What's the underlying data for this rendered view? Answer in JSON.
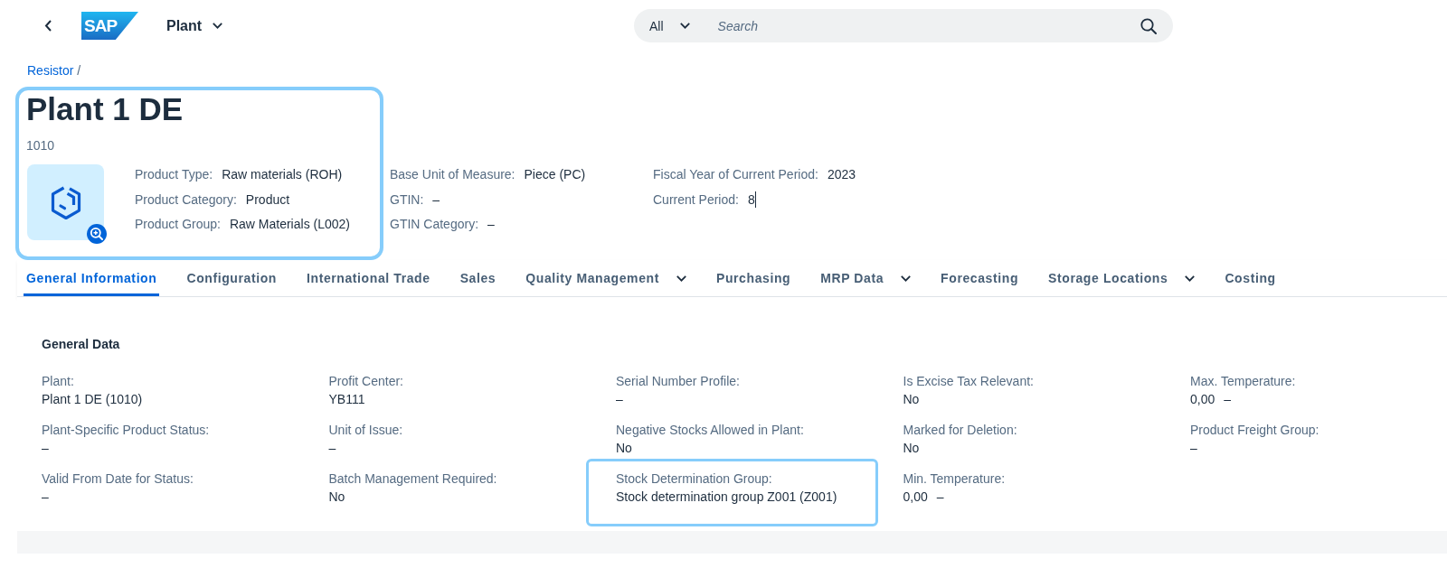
{
  "shell": {
    "logo": "SAP",
    "product_title": "Plant",
    "search": {
      "scope": "All",
      "placeholder": "Search"
    }
  },
  "breadcrumb": {
    "links": [
      "Resistor"
    ],
    "separator": "/"
  },
  "header": {
    "title": "Plant 1 DE",
    "subtitle": "1010",
    "highlighted": true,
    "attribute_columns": [
      [
        {
          "label": "Product Type:",
          "value": "Raw materials (ROH)",
          "cursor": false
        },
        {
          "label": "Product Category:",
          "value": "Product",
          "cursor": false
        },
        {
          "label": "Product Group:",
          "value": "Raw Materials (L002)",
          "cursor": false
        }
      ],
      [
        {
          "label": "Base Unit of Measure:",
          "value": "Piece (PC)",
          "cursor": false
        },
        {
          "label": "GTIN:",
          "value": "–",
          "cursor": false
        },
        {
          "label": "GTIN Category:",
          "value": "–",
          "cursor": false
        }
      ],
      [
        {
          "label": "Fiscal Year of Current Period:",
          "value": "2023",
          "cursor": false
        },
        {
          "label": "Current Period:",
          "value": "8",
          "cursor": true
        }
      ]
    ]
  },
  "tabs": [
    {
      "label": "General Information",
      "selected": true,
      "has_menu": false
    },
    {
      "label": "Configuration",
      "selected": false,
      "has_menu": false
    },
    {
      "label": "International Trade",
      "selected": false,
      "has_menu": false
    },
    {
      "label": "Sales",
      "selected": false,
      "has_menu": false
    },
    {
      "label": "Quality Management",
      "selected": false,
      "has_menu": true
    },
    {
      "label": "Purchasing",
      "selected": false,
      "has_menu": false
    },
    {
      "label": "MRP Data",
      "selected": false,
      "has_menu": true
    },
    {
      "label": "Forecasting",
      "selected": false,
      "has_menu": false
    },
    {
      "label": "Storage Locations",
      "selected": false,
      "has_menu": true
    },
    {
      "label": "Costing",
      "selected": false,
      "has_menu": false
    }
  ],
  "section": {
    "title": "General Data",
    "fields": [
      {
        "label": "Plant:",
        "value": "Plant 1 DE (1010)",
        "highlighted": false
      },
      {
        "label": "Profit Center:",
        "value": "YB111",
        "highlighted": false
      },
      {
        "label": "Serial Number Profile:",
        "value": "–",
        "highlighted": false
      },
      {
        "label": "Is Excise Tax Relevant:",
        "value": "No",
        "highlighted": false
      },
      {
        "label": "Max. Temperature:",
        "value": "0,00",
        "unit": "–",
        "highlighted": false
      },
      {
        "label": "Plant-Specific Product Status:",
        "value": "–",
        "highlighted": false
      },
      {
        "label": "Unit of Issue:",
        "value": "–",
        "highlighted": false
      },
      {
        "label": "Negative Stocks Allowed in Plant:",
        "value": "No",
        "highlighted": false
      },
      {
        "label": "Marked for Deletion:",
        "value": "No",
        "highlighted": false
      },
      {
        "label": "Product Freight Group:",
        "value": "–",
        "highlighted": false
      },
      {
        "label": "Valid From Date for Status:",
        "value": "–",
        "highlighted": false
      },
      {
        "label": "Batch Management Required:",
        "value": "No",
        "highlighted": false
      },
      {
        "label": "Stock Determination Group:",
        "value": "Stock determination group Z001 (Z001)",
        "highlighted": true
      },
      {
        "label": "Min. Temperature:",
        "value": "0,00",
        "unit": "–",
        "highlighted": false
      }
    ]
  }
}
